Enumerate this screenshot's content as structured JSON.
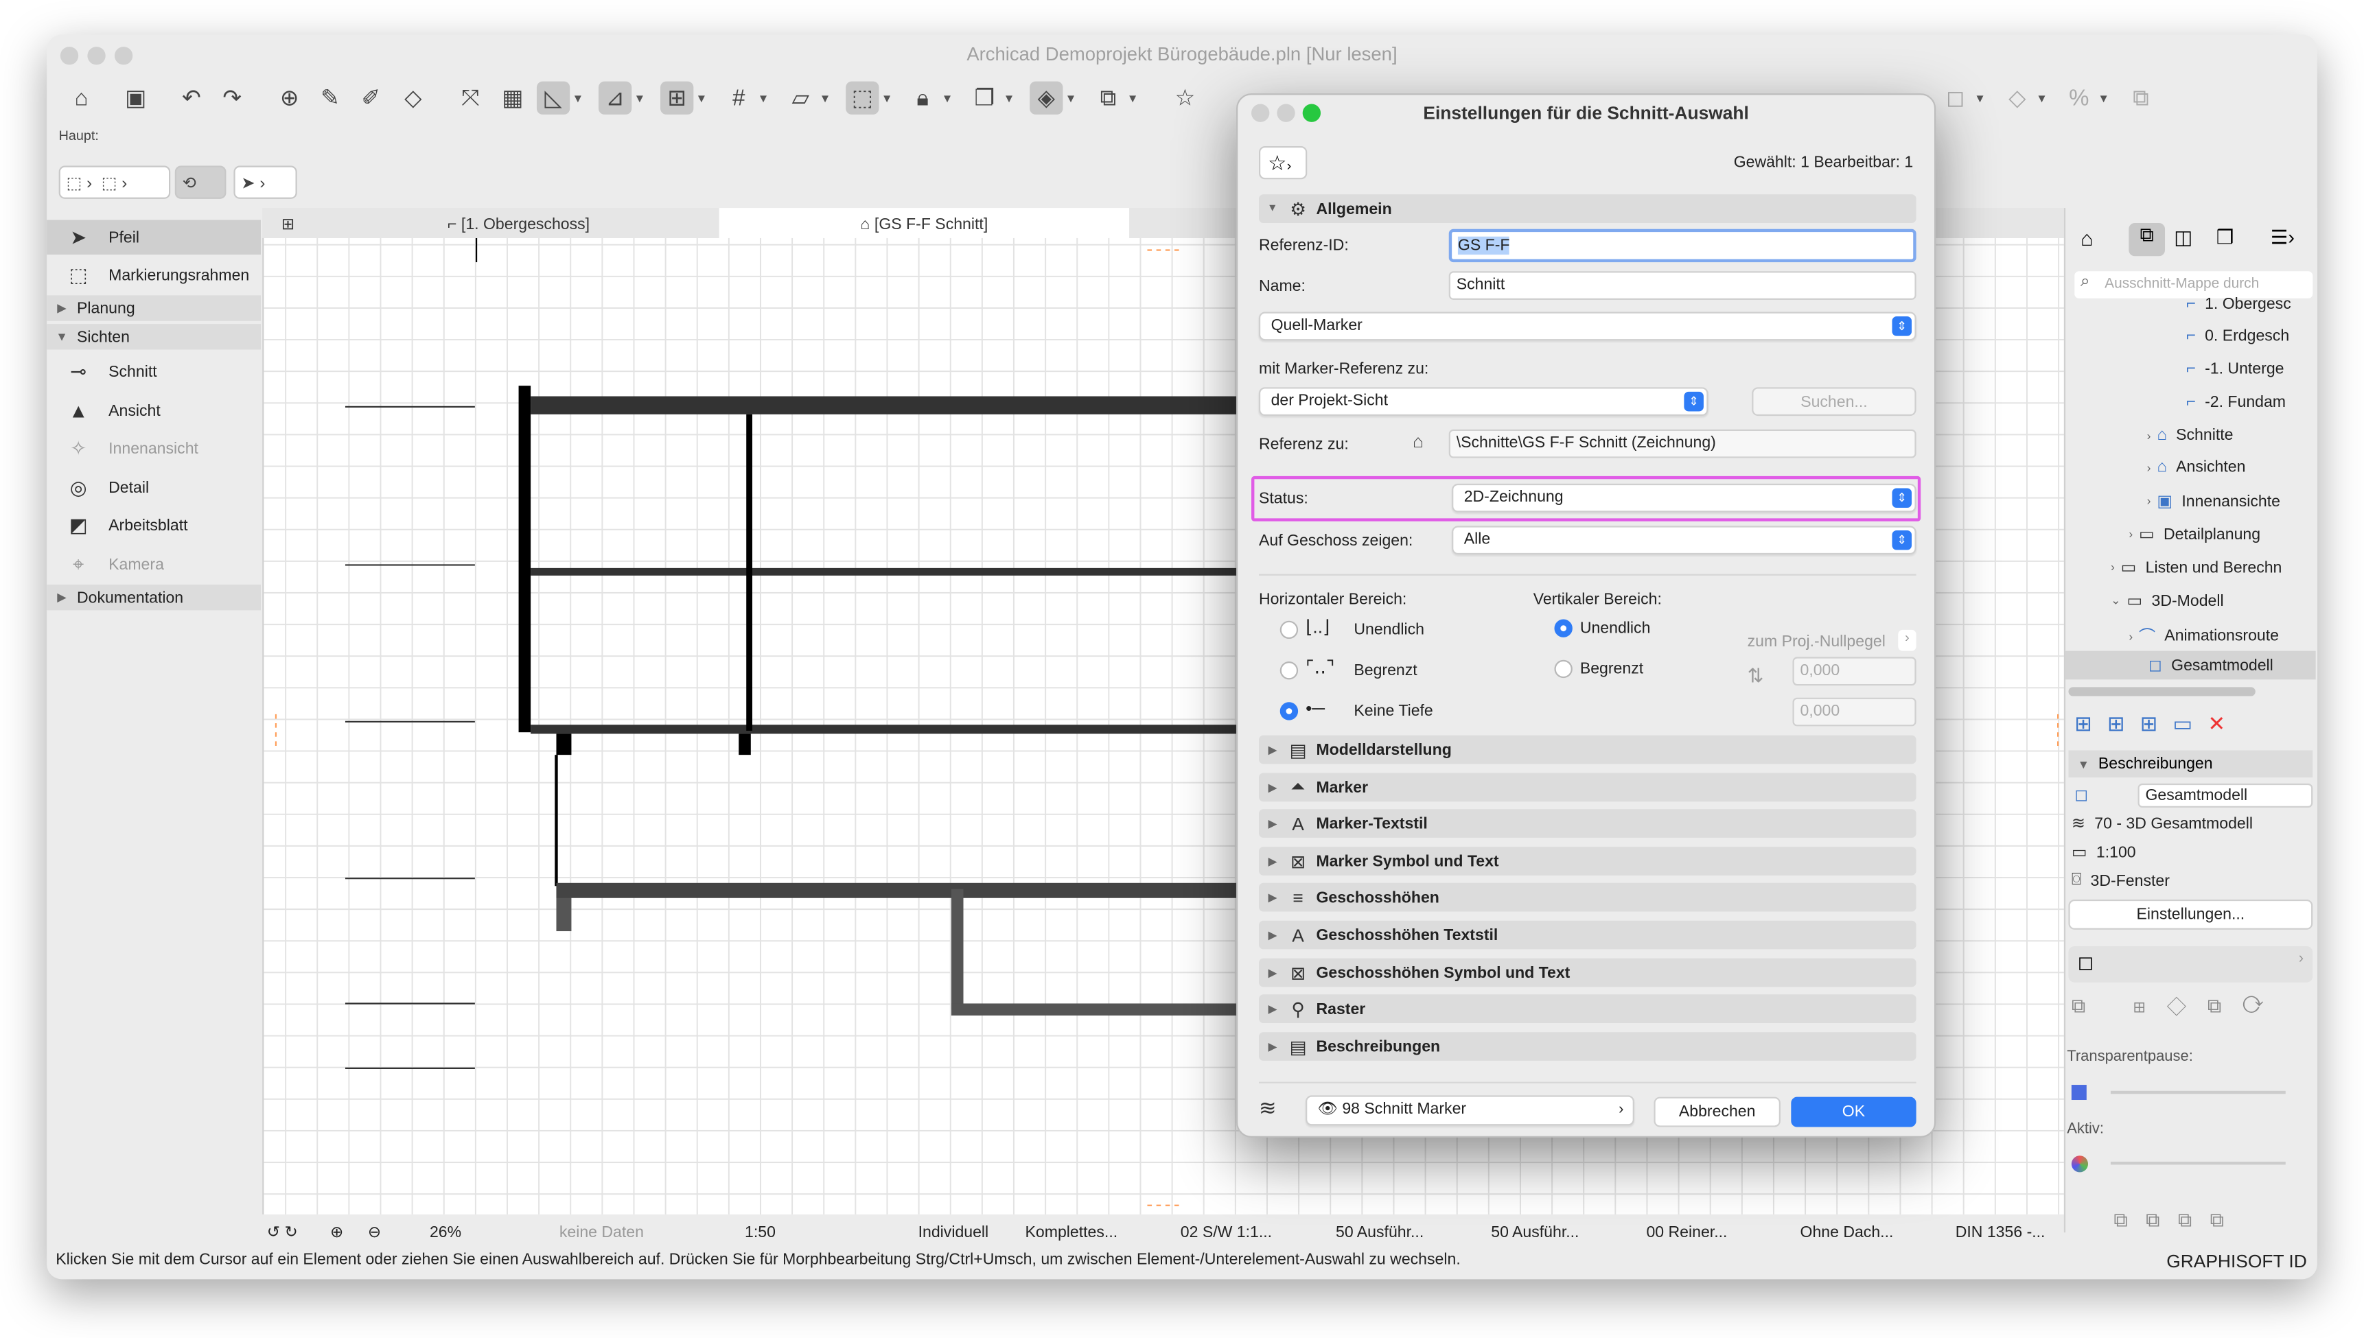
{
  "window": {
    "title": "Archicad Demoprojekt Bürogebäude.pln [Nur lesen]"
  },
  "toolbar": {
    "haupt_label": "Haupt:"
  },
  "left_panel": {
    "tools": [
      {
        "label": "Pfeil",
        "icon": "arrow-icon"
      },
      {
        "label": "Markierungsrahmen",
        "icon": "marquee-icon"
      }
    ],
    "group_planung": "Planung",
    "group_sichten": "Sichten",
    "sichten": [
      {
        "label": "Schnitt"
      },
      {
        "label": "Ansicht"
      },
      {
        "label": "Innenansicht"
      },
      {
        "label": "Detail"
      },
      {
        "label": "Arbeitsblatt"
      },
      {
        "label": "Kamera"
      }
    ],
    "group_dokumentation": "Dokumentation"
  },
  "tabs": [
    {
      "label": "[1. Obergeschoss]"
    },
    {
      "label": "[GS F-F Schnitt]"
    }
  ],
  "navigator": {
    "search_placeholder": "Ausschnitt-Mappe durch",
    "tree": [
      {
        "label": "1. Obergesc"
      },
      {
        "label": "0. Erdgesch"
      },
      {
        "label": "-1. Unterge"
      },
      {
        "label": "-2. Fundam"
      },
      {
        "label": "Schnitte"
      },
      {
        "label": "Ansichten"
      },
      {
        "label": "Innenansichte"
      },
      {
        "label": "Detailplanung"
      },
      {
        "label": "Listen und Berechn"
      },
      {
        "label": "3D-Modell"
      },
      {
        "label": "Animationsroute"
      },
      {
        "label": "Gesamtmodell"
      }
    ],
    "beschreibungen_label": "Beschreibungen",
    "props": {
      "name": "Gesamtmodell",
      "layer": "70 - 3D Gesamtmodell",
      "scale": "1:100",
      "window": "3D-Fenster"
    },
    "einstellungen_button": "Einstellungen...",
    "transparent_label": "Transparentpause:",
    "aktiv_label": "Aktiv:"
  },
  "status_bar": {
    "zoom": "26%",
    "keine_daten": "keine Daten",
    "scale": "1:50",
    "individuell": "Individuell",
    "komplettes": "Komplettes...",
    "sw": "02 S/W 1:1...",
    "ausf1": "50 Ausführ...",
    "ausf2": "50 Ausführ...",
    "reiner": "00 Reiner...",
    "ohne_dach": "Ohne Dach...",
    "din": "DIN 1356 -...",
    "hint": "Klicken Sie mit dem Cursor auf ein Element oder ziehen Sie einen Auswahlbereich auf. Drücken Sie für Morphbearbeitung Strg/Ctrl+Umsch, um zwischen Element-/Unterelement-Auswahl zu wechseln.",
    "graphisoft": "GRAPHISOFT ID"
  },
  "dialog": {
    "title": "Einstellungen für die Schnitt-Auswahl",
    "selected": "Gewählt: 1 Bearbeitbar: 1",
    "section_allgemein": "Allgemein",
    "referenz_id_label": "Referenz-ID:",
    "referenz_id_value": "GS F-F",
    "name_label": "Name:",
    "name_value": "Schnitt",
    "quell_marker": "Quell-Marker",
    "mit_marker_label": "mit Marker-Referenz zu:",
    "projekt_sicht": "der Projekt-Sicht",
    "suchen_button": "Suchen...",
    "referenz_zu_label": "Referenz zu:",
    "referenz_zu_value": "\\Schnitte\\GS F-F Schnitt (Zeichnung)",
    "status_label": "Status:",
    "status_value": "2D-Zeichnung",
    "geschoss_label": "Auf Geschoss zeigen:",
    "geschoss_value": "Alle",
    "horizontal_label": "Horizontaler Bereich:",
    "h_options": [
      "Unendlich",
      "Begrenzt",
      "Keine Tiefe"
    ],
    "vertical_label": "Vertikaler Bereich:",
    "v_options": [
      "Unendlich",
      "Begrenzt"
    ],
    "nullpegel_label": "zum Proj.-Nullpegel",
    "v_value1": "0,000",
    "v_value2": "0,000",
    "sections": [
      "Modelldarstellung",
      "Marker",
      "Marker-Textstil",
      "Marker Symbol und Text",
      "Geschosshöhen",
      "Geschosshöhen Textstil",
      "Geschosshöhen Symbol und Text",
      "Raster",
      "Beschreibungen"
    ],
    "layer_value": "98 Schnitt Marker",
    "cancel": "Abbrechen",
    "ok": "OK",
    "highlight_color": "#e05ce6",
    "accent_color": "#2f7cf6"
  }
}
